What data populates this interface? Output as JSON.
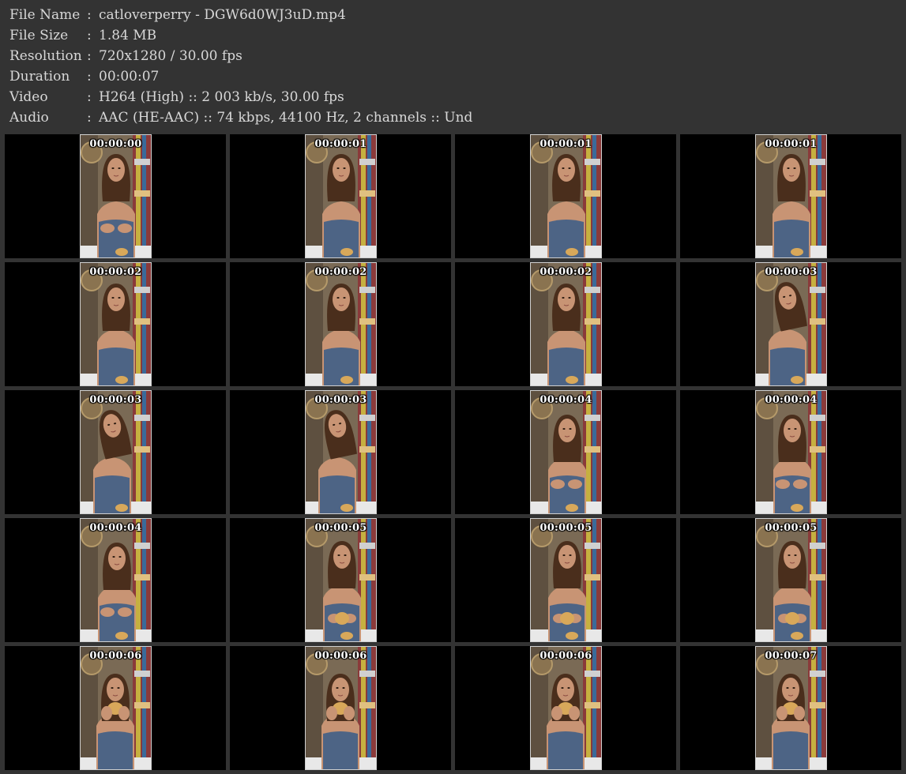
{
  "info": [
    {
      "label": "File Name",
      "sep": ":",
      "value": "catloverperry - DGW6d0WJ3uD.mp4"
    },
    {
      "label": "File Size",
      "sep": ":",
      "value": "1.84 MB"
    },
    {
      "label": "Resolution",
      "sep": ":",
      "value": "720x1280 / 30.00 fps"
    },
    {
      "label": "Duration",
      "sep": ":",
      "value": "00:00:07"
    },
    {
      "label": "Video",
      "sep": ":",
      "value": "H264 (High) :: 2 003 kb/s, 30.00 fps"
    },
    {
      "label": "Audio",
      "sep": ":",
      "value": "AAC (HE-AAC) :: 74 kbps, 44100 Hz, 2 channels :: Und"
    }
  ],
  "thumbnails": [
    {
      "time": "00:00:00",
      "pose": "hands"
    },
    {
      "time": "00:00:01",
      "pose": "smile"
    },
    {
      "time": "00:00:01",
      "pose": "smile"
    },
    {
      "time": "00:00:01",
      "pose": "smile"
    },
    {
      "time": "00:00:02",
      "pose": "neutral"
    },
    {
      "time": "00:00:02",
      "pose": "neutral"
    },
    {
      "time": "00:00:02",
      "pose": "neutral"
    },
    {
      "time": "00:00:03",
      "pose": "tilt"
    },
    {
      "time": "00:00:03",
      "pose": "tilt"
    },
    {
      "time": "00:00:03",
      "pose": "tilt"
    },
    {
      "time": "00:00:04",
      "pose": "down"
    },
    {
      "time": "00:00:04",
      "pose": "down"
    },
    {
      "time": "00:00:04",
      "pose": "down"
    },
    {
      "time": "00:00:05",
      "pose": "muffin"
    },
    {
      "time": "00:00:05",
      "pose": "muffin"
    },
    {
      "time": "00:00:05",
      "pose": "muffin"
    },
    {
      "time": "00:00:06",
      "pose": "eating"
    },
    {
      "time": "00:00:06",
      "pose": "eating"
    },
    {
      "time": "00:00:06",
      "pose": "eating"
    },
    {
      "time": "00:00:07",
      "pose": "eating"
    }
  ],
  "colors": {
    "header_bg": "#333333",
    "header_text": "#d8d8d8",
    "cell_bg": "#000000",
    "timestamp": "#ffffff",
    "top": "#4d6485",
    "hair": "#4a2e1c",
    "skin": "#c89474",
    "muffin": "#d8a85a"
  }
}
